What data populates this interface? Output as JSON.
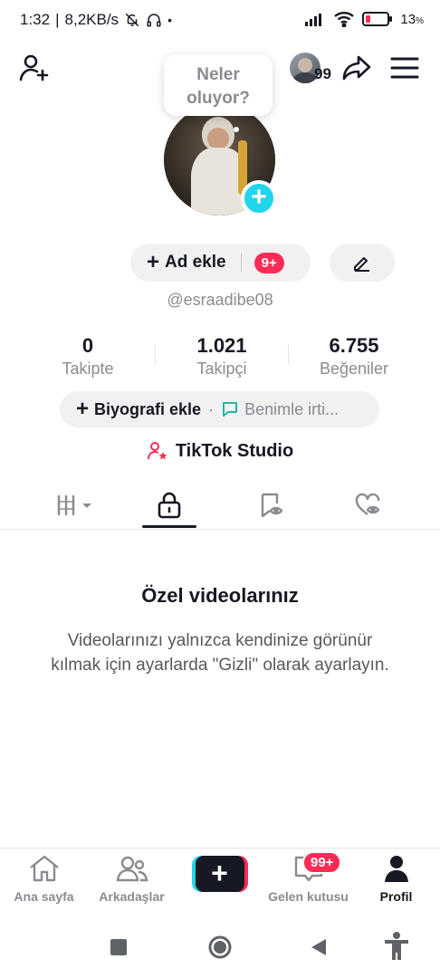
{
  "status_bar": {
    "time": "1:32",
    "speed": "8,2KB/s",
    "battery": "13"
  },
  "top_bar": {
    "avatar_badge": "99"
  },
  "bubble": {
    "line1": "Neler",
    "line2": "oluyor?"
  },
  "profile": {
    "name_button": "Ad ekle",
    "name_badge": "9+",
    "username": "@esraadibe08"
  },
  "stats": [
    {
      "value": "0",
      "label": "Takipte"
    },
    {
      "value": "1.021",
      "label": "Takipçi"
    },
    {
      "value": "6.755",
      "label": "Beğeniler"
    }
  ],
  "bio": {
    "add_label": "Biyografi ekle",
    "contact_label": "Benimle irti..."
  },
  "studio": {
    "label": "TikTok Studio"
  },
  "empty_state": {
    "title": "Özel videolarınız",
    "description": "Videolarınızı yalnızca kendinize görünür kılmak için ayarlarda \"Gizli\" olarak ayarlayın."
  },
  "bottom_nav": {
    "items": [
      {
        "label": "Ana sayfa"
      },
      {
        "label": "Arkadaşlar"
      },
      {
        "label": ""
      },
      {
        "label": "Gelen kutusu"
      },
      {
        "label": "Profil"
      }
    ],
    "inbox_badge": "99+"
  },
  "colors": {
    "accent_red": "#fe2c55",
    "accent_cyan": "#20d5ec",
    "text_gray": "#8a8b91"
  }
}
